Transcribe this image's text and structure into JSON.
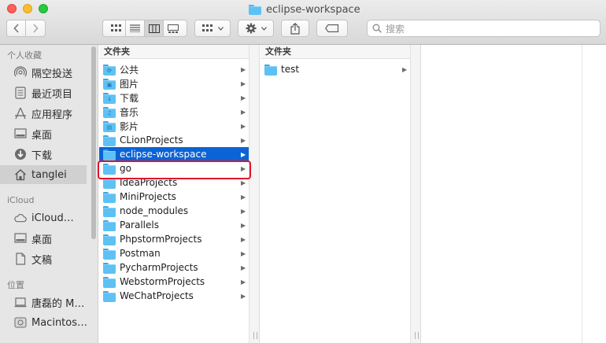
{
  "window": {
    "title": "eclipse-workspace"
  },
  "toolbar": {
    "search_placeholder": "搜索"
  },
  "sidebar": {
    "favorites_header": "个人收藏",
    "favorites": [
      {
        "label": "隔空投送",
        "icon": "airdrop-icon"
      },
      {
        "label": "最近项目",
        "icon": "recents-icon"
      },
      {
        "label": "应用程序",
        "icon": "applications-icon"
      },
      {
        "label": "桌面",
        "icon": "desktop-icon"
      },
      {
        "label": "下载",
        "icon": "downloads-icon"
      },
      {
        "label": "tanglei",
        "icon": "home-icon",
        "selected": true
      }
    ],
    "icloud_header": "iCloud",
    "icloud": [
      {
        "label": "iCloud…",
        "icon": "cloud-icon"
      },
      {
        "label": "桌面",
        "icon": "desktop-icon"
      },
      {
        "label": "文稿",
        "icon": "document-icon"
      }
    ],
    "locations_header": "位置",
    "locations": [
      {
        "label": "唐磊的 M…",
        "icon": "computer-icon"
      },
      {
        "label": "Macintos…",
        "icon": "disk-icon"
      }
    ]
  },
  "column1": {
    "header": "文件夹",
    "items": [
      {
        "name": "公共"
      },
      {
        "name": "图片"
      },
      {
        "name": "下载"
      },
      {
        "name": "音乐"
      },
      {
        "name": "影片"
      },
      {
        "name": "CLionProjects"
      },
      {
        "name": "eclipse-workspace",
        "selected": true
      },
      {
        "name": "go",
        "highlighted": true
      },
      {
        "name": "IdeaProjects"
      },
      {
        "name": "MiniProjects"
      },
      {
        "name": "node_modules"
      },
      {
        "name": "Parallels"
      },
      {
        "name": "PhpstormProjects"
      },
      {
        "name": "Postman"
      },
      {
        "name": "PycharmProjects"
      },
      {
        "name": "WebstormProjects"
      },
      {
        "name": "WeChatProjects"
      }
    ]
  },
  "column2": {
    "header": "文件夹",
    "items": [
      {
        "name": "test"
      }
    ]
  },
  "colors": {
    "selection": "#0b63d6",
    "annotation": "#e0142c",
    "folder": "#5ec1f3"
  }
}
